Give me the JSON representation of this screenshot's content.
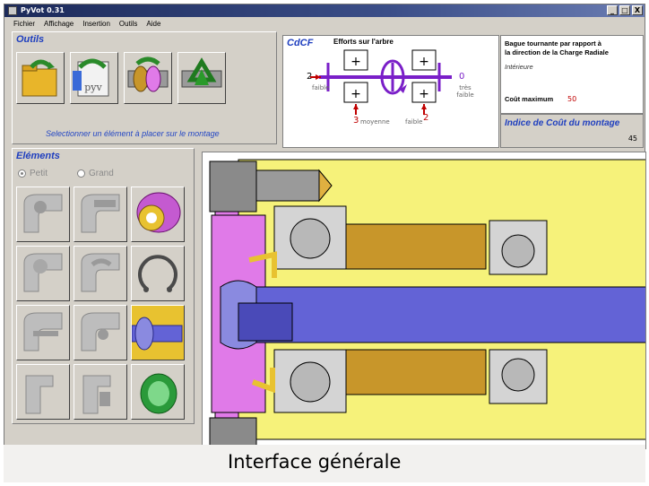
{
  "window": {
    "title": "PyVot 0.31",
    "buttons": [
      "_",
      "□",
      "X"
    ]
  },
  "menu": [
    "Fichier",
    "Affichage",
    "Insertion",
    "Outils",
    "Aide"
  ],
  "tools": {
    "title": "Outils",
    "hint": "Selectionner un élément à placer sur le montage",
    "items": [
      {
        "name": "open-folder-icon"
      },
      {
        "name": "pyv-file-icon",
        "label": "pyv"
      },
      {
        "name": "assembly-icon"
      },
      {
        "name": "recycle-icon"
      }
    ]
  },
  "cdcf": {
    "title": "CdCF",
    "efforts_title": "Efforts sur l'arbre",
    "left_value": "2",
    "left_label": "faible",
    "right_value": "0",
    "right_label": "très faible",
    "bottom_left_value": "3",
    "bottom_left_label": "moyenne",
    "bottom_right_label": "faible",
    "bottom_right_value": "2",
    "bague_title_1": "Bague tournante par rapport à",
    "bague_title_2": "la direction de la Charge Radiale",
    "bague_value": "Intérieure",
    "cout_label": "Coût maximum",
    "cout_value": "50",
    "indice_label": "Indice de Coût du montage",
    "indice_value": "45"
  },
  "elements": {
    "title": "Eléments",
    "radio_small": "Petit",
    "radio_large": "Grand",
    "selected": "Petit"
  },
  "caption": "Interface générale",
  "colors": {
    "title_blue": "#1f3fbf",
    "purple": "#7a1fc8",
    "housing_yellow": "#f6f27a",
    "shaft_blue": "#6363d6",
    "magenta": "#e07ae8",
    "bronze": "#c8962a",
    "red_value": "#c00000"
  }
}
